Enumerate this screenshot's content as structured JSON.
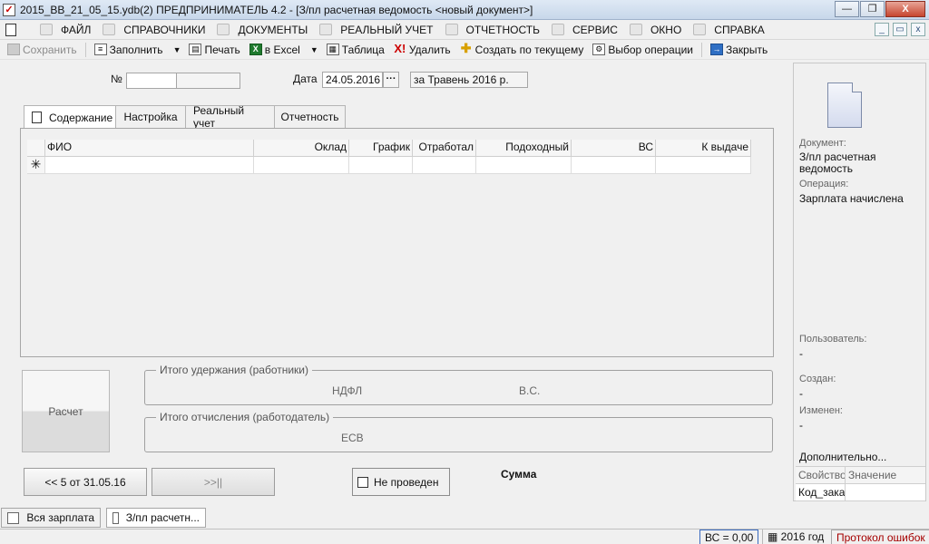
{
  "window": {
    "title": "2015_BB_21_05_15.ydb(2)  ПРЕДПРИНИМАТЕЛЬ 4.2 - [З/пл расчетная ведомость <новый документ>]",
    "min_glyph": "—",
    "max_glyph": "❐",
    "close_glyph": "X"
  },
  "menu": {
    "items": [
      {
        "label": "ФАЙЛ"
      },
      {
        "label": "СПРАВОЧНИКИ"
      },
      {
        "label": "ДОКУМЕНТЫ"
      },
      {
        "label": "РЕАЛЬНЫЙ УЧЕТ"
      },
      {
        "label": "ОТЧЕТНОСТЬ"
      },
      {
        "label": "СЕРВИС"
      },
      {
        "label": "ОКНО"
      },
      {
        "label": "СПРАВКА"
      }
    ],
    "mdi_min": "_",
    "mdi_restore": "▭",
    "mdi_close": "x"
  },
  "toolbar": {
    "save": "Сохранить",
    "fill": "Заполнить",
    "print": "Печать",
    "excel": "в Excel",
    "table": "Таблица",
    "delete": "Удалить",
    "create_by_current": "Создать по текущему",
    "choose_operation": "Выбор операции",
    "close": "Закрыть"
  },
  "form": {
    "number_label": "№",
    "number_value": "",
    "date_label": "Дата",
    "date_value": "24.05.2016",
    "period_value": "за Травень 2016 р."
  },
  "tabs": [
    {
      "label": "Содержание"
    },
    {
      "label": "Настройка"
    },
    {
      "label": "Реальный учет"
    },
    {
      "label": "Отчетность"
    }
  ],
  "grid": {
    "columns": [
      "ФИО",
      "Оклад",
      "График",
      "Отработал",
      "Подоходный",
      "ВС",
      "К выдаче"
    ],
    "new_row_marker": "✳"
  },
  "calc_button": "Расчет",
  "withholdings": {
    "legend": "Итого удержания (работники)",
    "ndfl": "НДФЛ",
    "vs": "В.С."
  },
  "contributions": {
    "legend": "Итого отчисления (работодатель)",
    "esv": "ЕСВ"
  },
  "nav": {
    "prev": "<< 5 от 31.05.16",
    "next": ">>||"
  },
  "status_toggle": "Не проведен",
  "summa_label": "Сумма",
  "right_panel": {
    "document_label": "Документ:",
    "document_value": "З/пл расчетная ведомость",
    "operation_label": "Операция:",
    "operation_value": "Зарплата начислена",
    "user_label": "Пользователь:",
    "user_value": "-",
    "created_label": "Создан:",
    "created_value": "-",
    "modified_label": "Изменен:",
    "modified_value": "-",
    "more_label": "Дополнительно...",
    "table_head": [
      "Свойство",
      "Значение"
    ],
    "table_rows": [
      {
        "prop": "Код_зака",
        "val": ""
      }
    ]
  },
  "bottom_tabs": [
    {
      "label": "Вся зарплата"
    },
    {
      "label": "З/пл расчетн..."
    }
  ],
  "statusbar": {
    "vs": "ВС = 0,00",
    "year": "2016 год",
    "errors": "Протокол ошибок"
  }
}
